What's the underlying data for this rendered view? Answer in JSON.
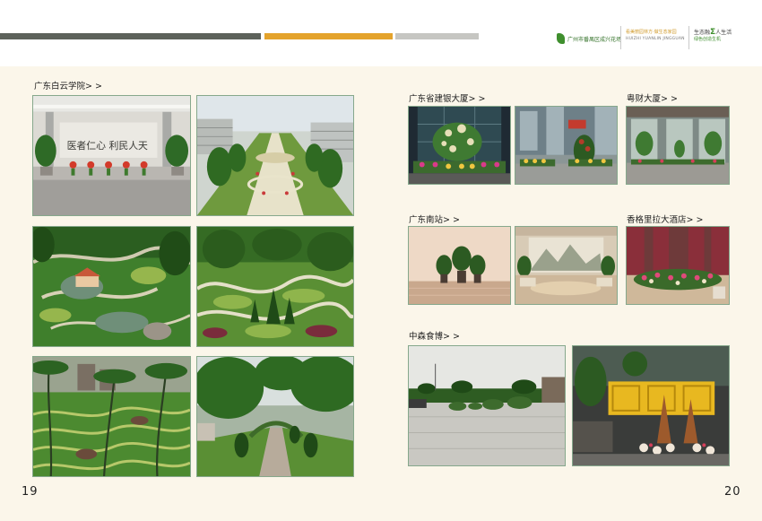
{
  "header": {
    "logo_left_text": "广州市番禺区成兴花场",
    "logo_mid_line1": "看美丽园林方·做生态家园",
    "logo_mid_line2": "HUIZHI YUANLIN JINGGUAN",
    "logo_right_line1_a": "生态融",
    "logo_right_sigma": "Σ",
    "logo_right_line1_b": "人生活",
    "logo_right_line2": "绿色创造生机"
  },
  "sections": {
    "baiyun": "广东白云学院> >",
    "jianyin": "广东省建银大厦> >",
    "yuecai": "粤财大厦> >",
    "nanzhan": "广东南站> >",
    "shangri": "香格里拉大酒店> >",
    "zhongsen": "中森食博> >"
  },
  "pages": {
    "left": "19",
    "right": "20"
  }
}
